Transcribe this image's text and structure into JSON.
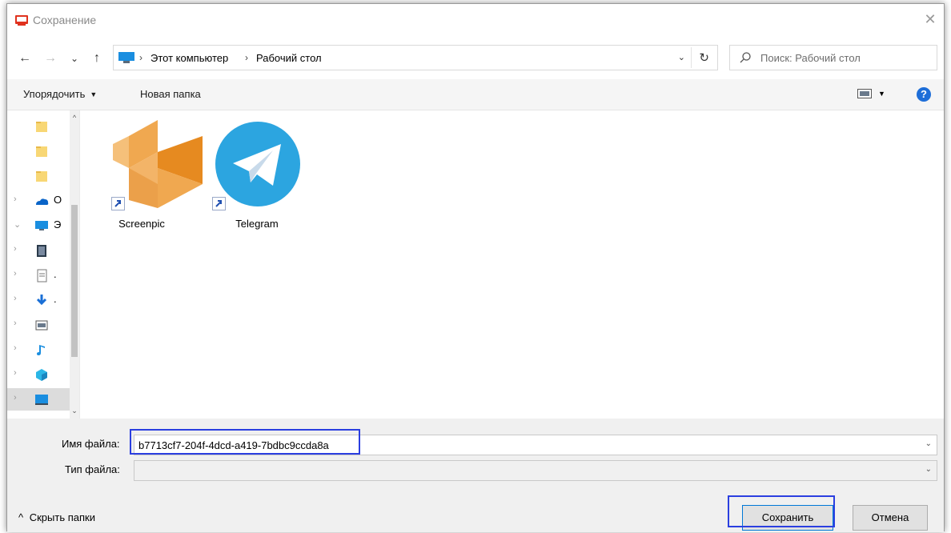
{
  "window": {
    "title": "Сохранение",
    "close_glyph": "✕"
  },
  "navigation": {
    "back_glyph": "←",
    "forward_glyph": "→",
    "recent_glyph": "⌄",
    "up_glyph": "↑",
    "breadcrumbs": [
      "Этот компьютер",
      "Рабочий стол"
    ],
    "crumb_separator": "›",
    "dropdown_glyph": "⌄",
    "refresh_glyph": "↻",
    "search_placeholder": "Поиск: Рабочий стол"
  },
  "toolbar": {
    "organize_label": "Упорядочить",
    "organize_caret": "▼",
    "new_folder_label": "Новая папка",
    "view_caret": "▼",
    "help_glyph": "?"
  },
  "nav_pane": {
    "items": [
      {
        "icon": "folder-icon",
        "label": "",
        "chevron": ""
      },
      {
        "icon": "folder-icon",
        "label": "",
        "chevron": ""
      },
      {
        "icon": "folder-icon",
        "label": "",
        "chevron": ""
      },
      {
        "icon": "onedrive-icon",
        "label": "O",
        "chevron": "›"
      },
      {
        "icon": "computer-icon",
        "label": "Э",
        "chevron": "⌄"
      },
      {
        "icon": "video-icon",
        "label": "",
        "chevron": "›"
      },
      {
        "icon": "document-icon",
        "label": ".",
        "chevron": "›"
      },
      {
        "icon": "download-icon",
        "label": ".",
        "chevron": "›"
      },
      {
        "icon": "picture-icon",
        "label": "",
        "chevron": "›"
      },
      {
        "icon": "music-icon",
        "label": "",
        "chevron": "›"
      },
      {
        "icon": "3d-objects-icon",
        "label": "",
        "chevron": "›"
      },
      {
        "icon": "desktop-icon",
        "label": "",
        "chevron": "›"
      }
    ],
    "scroll_up_glyph": "^",
    "scroll_down_glyph": "⌄"
  },
  "files": [
    {
      "name": "Screenpic",
      "icon": "screenpic-icon"
    },
    {
      "name": "Telegram",
      "icon": "telegram-icon"
    }
  ],
  "form": {
    "filename_label": "Имя файла:",
    "filename_value": "b7713cf7-204f-4dcd-a419-7bdbc9ccda8a",
    "filetype_label": "Тип файла:",
    "filetype_value": "",
    "dropdown_glyph": "⌄",
    "hide_folders_label": "Скрыть папки",
    "hide_folders_glyph": "^",
    "save_label": "Сохранить",
    "cancel_label": "Отмена"
  },
  "colors": {
    "highlight": "#2b3fe0",
    "telegram_blue": "#2ca5e0",
    "screenpic_orange": "#e8922f"
  }
}
